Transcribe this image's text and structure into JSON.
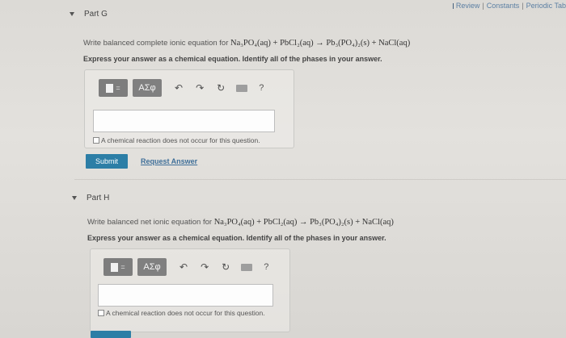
{
  "topnav": {
    "review_label": "Review",
    "sep1": "|",
    "constants_label": "Constants",
    "sep2": "|",
    "periodic_label": "Periodic Tab"
  },
  "partG": {
    "title": "Part G",
    "question_prefix": "Write balanced complete ionic equation for",
    "equation": "Na₃PO₄(aq) + PbCl₂(aq) → Pb₃(PO₄)₂(s) + NaCl(aq)",
    "instruction": "Express your answer as a chemical equation. Identify all of the phases in your answer.",
    "toolbar": {
      "greek": "ΑΣφ",
      "undo": "↶",
      "redo": "↷",
      "reset": "↻",
      "help": "?"
    },
    "answer_value": "",
    "no_reaction_label": "A chemical reaction does not occur for this question.",
    "submit_label": "Submit",
    "request_answer_label": "Request Answer"
  },
  "partH": {
    "title": "Part H",
    "question_prefix": "Write balanced net ionic equation for",
    "equation": "Na₃PO₄(aq) + PbCl₂(aq) → Pb₃(PO₄)₂(s) + NaCl(aq)",
    "instruction": "Express your answer as a chemical equation. Identify all of the phases in your answer.",
    "toolbar": {
      "greek": "ΑΣφ",
      "undo": "↶",
      "redo": "↷",
      "reset": "↻",
      "help": "?"
    },
    "answer_value": "",
    "no_reaction_label": "A chemical reaction does not occur for this question."
  }
}
